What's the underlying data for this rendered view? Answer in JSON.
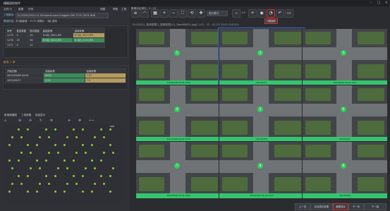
{
  "window": {
    "title": "精细巡检软件",
    "menu": [
      "文件(F)",
      "数据",
      "任务",
      "视图",
      "帮助",
      "工具"
    ]
  },
  "left": {
    "project_label": "工程路径:",
    "project_path": "D:\\2020\\2020-11-0\\import\\route-Kinggen DM 7175 (MT4-RHK",
    "info_label": "基础信息:",
    "info_value": "共3组影像 · 5175 张照片 · 3组 选择",
    "table1": {
      "headers": [
        "序号",
        "航线条数",
        "照片数量",
        "起始影像",
        "结束影像"
      ],
      "rows": [
        [
          "1175",
          "0",
          "19",
          "D:\\DJI_0001.JPG",
          "D:\\DJI_0019.JPG"
        ],
        [
          "1176",
          "29",
          "96",
          "D:\\DJI_0020.JPG",
          "D:\\DJI_0115.JPG"
        ],
        [
          "1177",
          "0",
          "11",
          "",
          ""
        ],
        [
          "",
          "",
          "",
          "",
          ""
        ]
      ]
    },
    "section2_label": "航线: 1 条",
    "table2": {
      "headers": [
        "开始日期",
        "起始影像",
        "结束影像"
      ],
      "rows": [
        [
          "2022/03/08 04:09",
          "0015",
          "7.97"
        ],
        [
          "2022/03/17",
          "0.03",
          "7.9"
        ]
      ]
    },
    "bottom_tabs": [
      "影像缩略图",
      "三维视图",
      "航迹显示"
    ],
    "map_points": [
      {
        "label": "1001",
        "col": 0,
        "row": 0
      }
    ]
  },
  "right": {
    "panel_title": "影像对比窗口 · 2 / 12",
    "toolbar_dropdown": "图片模式",
    "toolbar_value": "1.0",
    "active_tooltip": "计算面积",
    "path_label": "D:\\2022\\1_影像数据\\1_图像数据\\1\\1_RoadMAP\\1.jpg|1.1(1) · 12 · A1 (1) 12(2) (5)(2)(2)",
    "tiles": [
      {
        "caption": "20220308 04:09:1984",
        "selected": false,
        "num": "1"
      },
      {
        "caption": "20220317",
        "selected": true,
        "num": "2"
      },
      {
        "caption": "20220306 04:09:1971",
        "selected": false,
        "num": "3"
      },
      {
        "caption": "20220306 04:09:1935",
        "selected": false,
        "num": "4"
      },
      {
        "caption": "20220308",
        "selected": false,
        "num": "5"
      },
      {
        "caption": "20220307",
        "selected": false,
        "num": "6"
      },
      {
        "caption": "20220306 04:09:1984",
        "selected": false,
        "num": "7"
      },
      {
        "caption": "20220306 04:09:1997",
        "selected": false,
        "num": "8"
      },
      {
        "caption": "20220308",
        "selected": false,
        "num": "9"
      }
    ],
    "bottom_buttons": [
      "上一页",
      "比较选中影像",
      "截图保存",
      "下一页",
      "下一组"
    ]
  }
}
